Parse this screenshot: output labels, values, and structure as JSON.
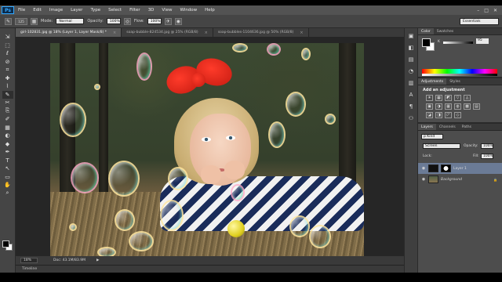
{
  "menubar": {
    "logo": "Ps",
    "items": [
      "File",
      "Edit",
      "Image",
      "Layer",
      "Type",
      "Select",
      "Filter",
      "3D",
      "View",
      "Window",
      "Help"
    ],
    "window_controls": [
      "–",
      "□",
      "✕"
    ]
  },
  "options": {
    "brush_size": "125",
    "mode_label": "Mode:",
    "mode_value": "Normal",
    "opacity_label": "Opacity:",
    "opacity_value": "100%",
    "flow_label": "Flow:",
    "flow_value": "100%",
    "workspace": "Essentials"
  },
  "tabs": [
    {
      "label": "girl-102831.jpg @ 18% (Layer 1, Layer Mask/8) *",
      "active": true
    },
    {
      "label": "soap-bubble-824534.jpg @ 25% (RGB/8)",
      "active": false
    },
    {
      "label": "soap-bubbles-1104636.jpg @ 50% (RGB/8)",
      "active": false
    }
  ],
  "tab_close": "×",
  "status": {
    "zoom": "18%",
    "doc": "Doc: 43.1M/83.9M",
    "arrow": "▶"
  },
  "timeline": {
    "label": "Timeline"
  },
  "tools": [
    "⇲",
    "⬚",
    "ℓ",
    "⊘",
    "⌗",
    "✚",
    "⌇",
    "✎",
    "✂",
    "⎘",
    "✐",
    "▦",
    "◐",
    "◆",
    "✒",
    "T",
    "↖",
    "▭",
    "✋",
    "⌕"
  ],
  "side_icons": [
    "▣",
    "◧",
    "▤",
    "◔",
    "▥",
    "A",
    "¶",
    "⚇"
  ],
  "color_panel": {
    "tabs": [
      "Color",
      "Swatches"
    ],
    "k_label": "K",
    "k_value": "95"
  },
  "adjustments_panel": {
    "tabs": [
      "Adjustments",
      "Styles"
    ],
    "title": "Add an adjustment",
    "row1": [
      "☀",
      "▦",
      "◩",
      "▽",
      "◬"
    ],
    "row2": [
      "▣",
      "◑",
      "▦",
      "◍",
      "▩",
      "▤"
    ],
    "row3": [
      "◪",
      "◨",
      "◸",
      "◇"
    ]
  },
  "layers_panel": {
    "tabs": [
      "Layers",
      "Channels",
      "Paths"
    ],
    "kind": "ρ Kind",
    "blend": "Screen",
    "opacity_label": "Opacity:",
    "opacity_value": "100%",
    "lock_label": "Lock:",
    "fill_label": "Fill:",
    "fill_value": "100%",
    "layers": [
      {
        "name": "Layer 1",
        "selected": true
      },
      {
        "name": "Background",
        "selected": false,
        "lock": "🔒"
      }
    ],
    "visibility": "◉"
  }
}
